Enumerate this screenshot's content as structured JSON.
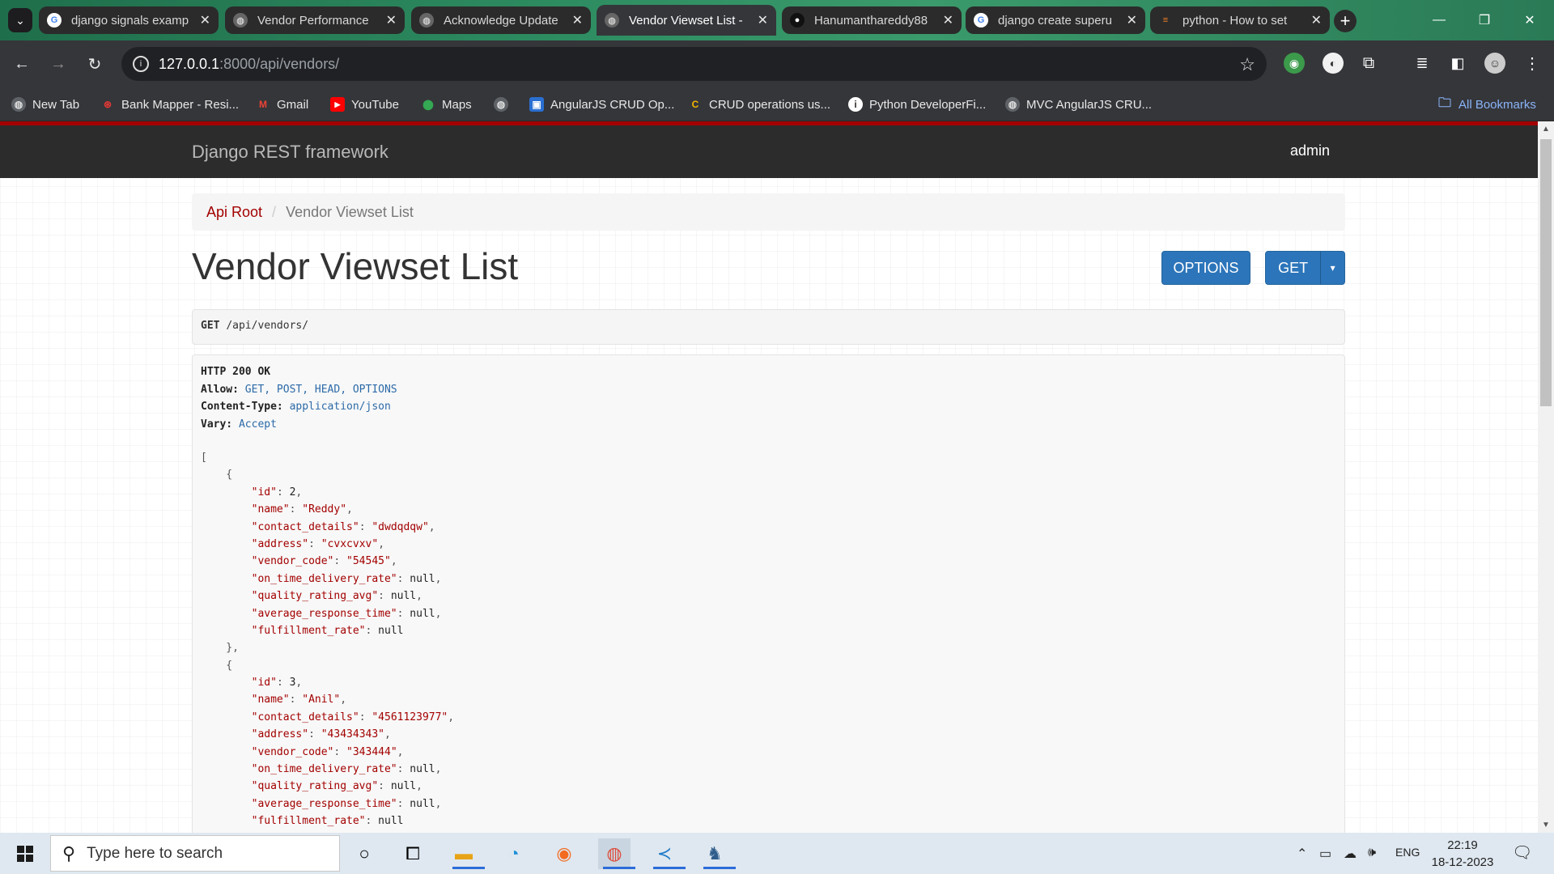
{
  "browser": {
    "tabs": [
      {
        "title": "django signals examp",
        "favicon": "google-icon",
        "active": false
      },
      {
        "title": "Vendor Performance",
        "favicon": "globe-icon",
        "active": false
      },
      {
        "title": "Acknowledge Update",
        "favicon": "globe-icon",
        "active": false
      },
      {
        "title": "Vendor Viewset List -",
        "favicon": "globe-icon",
        "active": true
      },
      {
        "title": "Hanumanthareddy88",
        "favicon": "github-icon",
        "active": false
      },
      {
        "title": "django create superu",
        "favicon": "google-icon",
        "active": false
      },
      {
        "title": "python - How to set",
        "favicon": "stackoverflow-icon",
        "active": false
      }
    ],
    "url_host": "127.0.0.1",
    "url_rest": ":8000/api/vendors/",
    "bookmarks": [
      {
        "label": "New Tab",
        "icon": "globe-icon"
      },
      {
        "label": "Bank Mapper - Resi...",
        "icon": "wifi-icon"
      },
      {
        "label": "Gmail",
        "icon": "gmail-icon"
      },
      {
        "label": "YouTube",
        "icon": "youtube-icon"
      },
      {
        "label": "Maps",
        "icon": "maps-pin-icon"
      },
      {
        "label": "",
        "icon": "globe-icon"
      },
      {
        "label": "AngularJS CRUD Op...",
        "icon": "image-icon"
      },
      {
        "label": "CRUD operations us...",
        "icon": "c-icon"
      },
      {
        "label": "Python DeveloperFi...",
        "icon": "info-icon"
      },
      {
        "label": "MVC AngularJS CRU...",
        "icon": "globe-icon"
      }
    ],
    "all_bookmarks": "All Bookmarks"
  },
  "page": {
    "brand": "Django REST framework",
    "user": "admin",
    "breadcrumb": {
      "root": "Api Root",
      "current": "Vendor Viewset List"
    },
    "title": "Vendor Viewset List",
    "options_button": "OPTIONS",
    "get_button": "GET",
    "request": {
      "method": "GET",
      "path": "/api/vendors/"
    },
    "response_headers": {
      "status": "HTTP 200 OK",
      "allow_key": "Allow:",
      "allow_value": "GET, POST, HEAD, OPTIONS",
      "ctype_key": "Content-Type:",
      "ctype_value": "application/json",
      "vary_key": "Vary:",
      "vary_value": "Accept"
    },
    "vendors": [
      {
        "id": "2",
        "name": "\"Reddy\"",
        "contact_details": "\"dwdqdqw\"",
        "address": "\"cvxcvxv\"",
        "vendor_code": "\"54545\"",
        "on_time_delivery_rate": "null",
        "quality_rating_avg": "null",
        "average_response_time": "null",
        "fulfillment_rate": "null"
      },
      {
        "id": "3",
        "name": "\"Anil\"",
        "contact_details": "\"4561123977\"",
        "address": "\"43434343\"",
        "vendor_code": "\"343444\"",
        "on_time_delivery_rate": "null",
        "quality_rating_avg": "null",
        "average_response_time": "null",
        "fulfillment_rate": "null"
      }
    ]
  },
  "taskbar": {
    "search_placeholder": "Type here to search",
    "language": "ENG",
    "time": "22:19",
    "date": "18-12-2023"
  }
}
